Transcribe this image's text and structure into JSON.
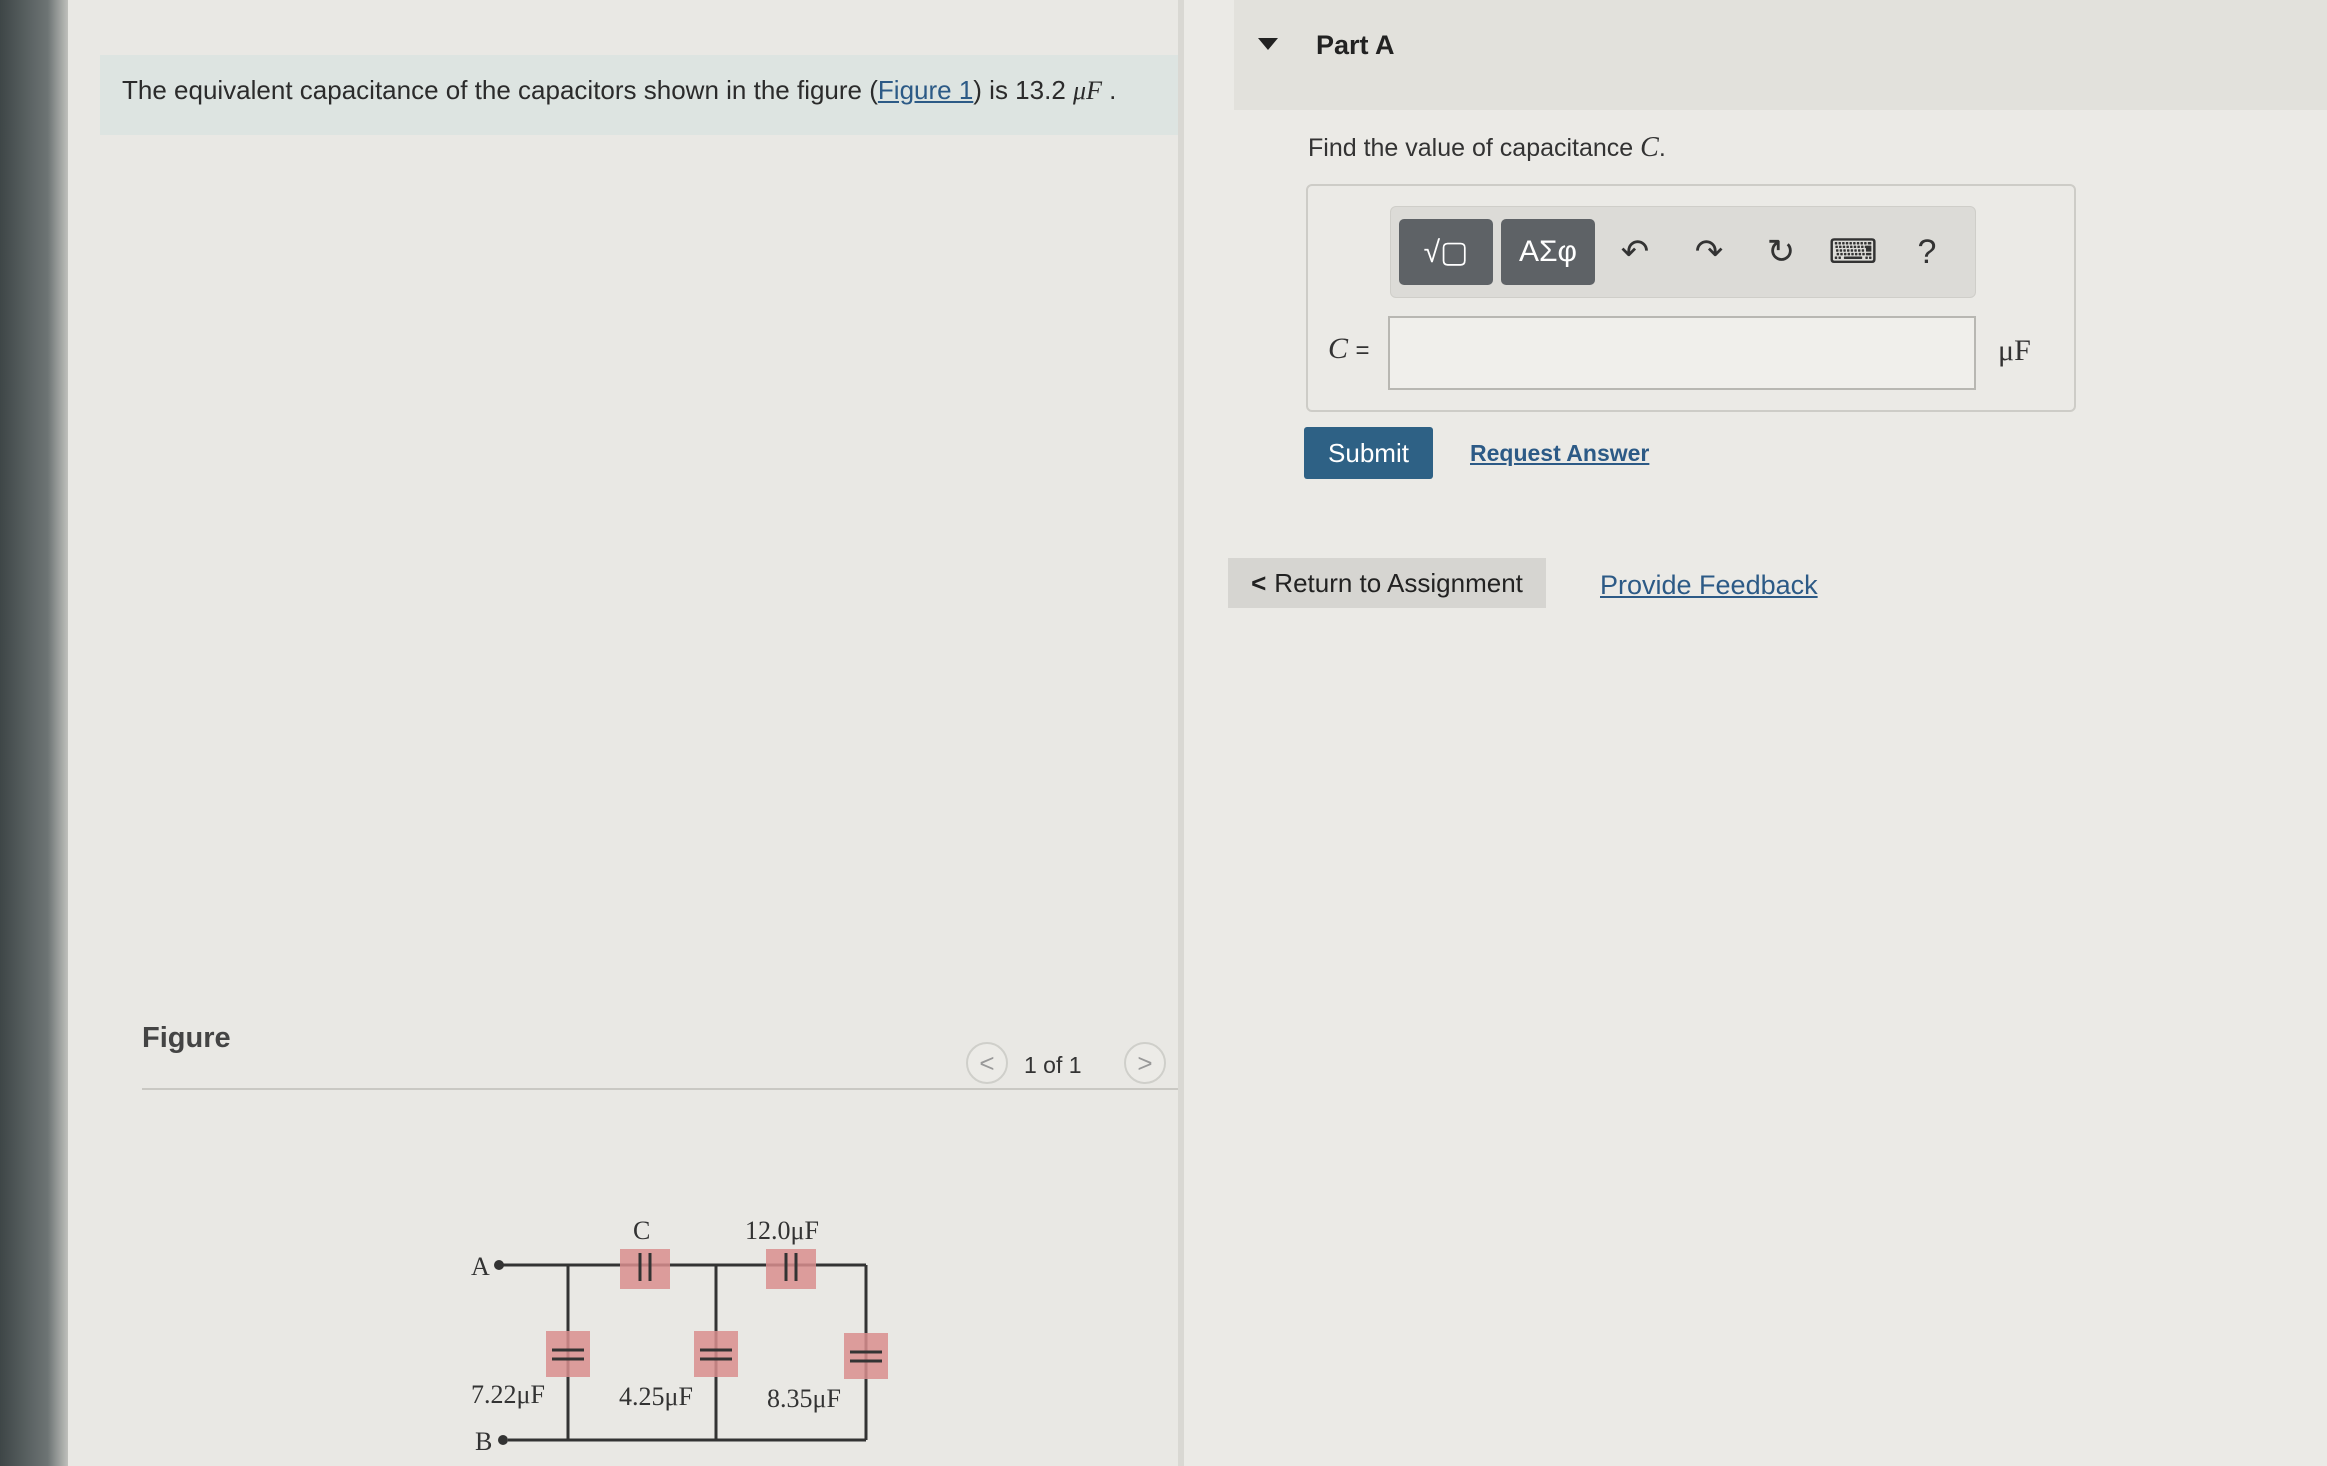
{
  "problem": {
    "intro_prefix": "The equivalent capacitance of the capacitors shown in the figure (",
    "figure_link": "Figure 1",
    "intro_mid": ") is 13.2 ",
    "intro_unit": "μF",
    "intro_suffix": " ."
  },
  "figure": {
    "label": "Figure",
    "pager": {
      "prev": "<",
      "next": ">",
      "text": "1 of 1"
    },
    "circuit": {
      "node_a": "A",
      "node_b": "B",
      "cap_c": "C",
      "cap_12": "12.0μF",
      "cap_722": "7.22μF",
      "cap_425": "4.25μF",
      "cap_835": "8.35μF"
    }
  },
  "part": {
    "title": "Part A",
    "question_prefix": "Find the value of capacitance ",
    "question_var": "C",
    "question_suffix": ".",
    "toolbar": {
      "templates_icon": "√▢",
      "symbols_label": "ΑΣφ",
      "undo_icon": "↶",
      "redo_icon": "↷",
      "reset_icon": "↻",
      "keyboard_icon": "⌨",
      "help_icon": "?"
    },
    "var_label": "C",
    "eq": "=",
    "answer_value": "",
    "unit": "μF",
    "submit_label": "Submit",
    "request_answer_label": "Request Answer"
  },
  "footer": {
    "return_label": "Return to Assignment",
    "return_chevron": "<",
    "feedback_label": "Provide Feedback"
  },
  "colors": {
    "submit_bg": "#2e6185",
    "link": "#2c5a86",
    "capacitor_highlight": "#d98e8e"
  }
}
